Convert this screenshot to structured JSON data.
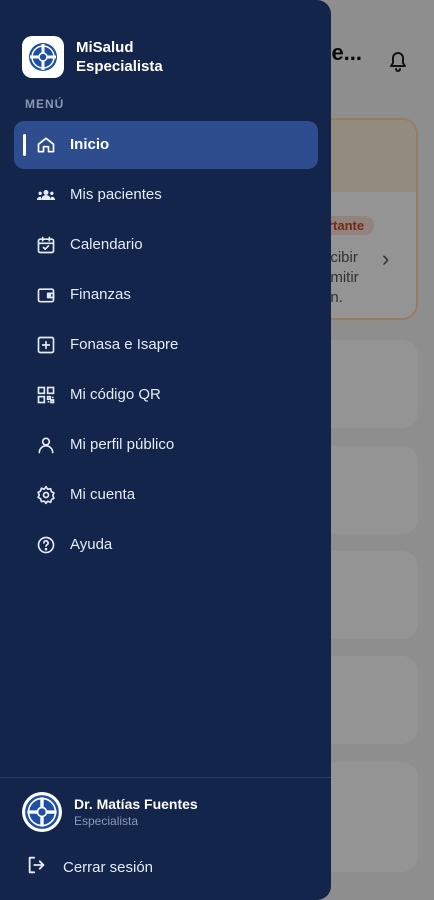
{
  "background": {
    "header_title": "ue...",
    "alert_badge": "rtante",
    "alert_text": "ecibir\nemitir\nón."
  },
  "brand": {
    "name_line1": "MiSalud",
    "name_line2": "Especialista"
  },
  "menu": {
    "section_label": "MENÚ",
    "items": [
      {
        "label": "Inicio",
        "icon": "home-icon",
        "active": true
      },
      {
        "label": "Mis pacientes",
        "icon": "patients-icon"
      },
      {
        "label": "Calendario",
        "icon": "calendar-icon"
      },
      {
        "label": "Finanzas",
        "icon": "wallet-icon"
      },
      {
        "label": "Fonasa e Isapre",
        "icon": "plus-square-icon"
      },
      {
        "label": "Mi código QR",
        "icon": "qr-code-icon"
      },
      {
        "label": "Mi perfil público",
        "icon": "user-icon"
      },
      {
        "label": "Mi cuenta",
        "icon": "gear-icon"
      },
      {
        "label": "Ayuda",
        "icon": "help-icon"
      }
    ]
  },
  "profile": {
    "name": "Dr. Matías Fuentes",
    "role": "Especialista"
  },
  "logout": {
    "label": "Cerrar sesión"
  },
  "colors": {
    "drawer_bg": "#13254a",
    "active_bg": "#2d4d8f",
    "logo_blue": "#1f4fa3"
  }
}
